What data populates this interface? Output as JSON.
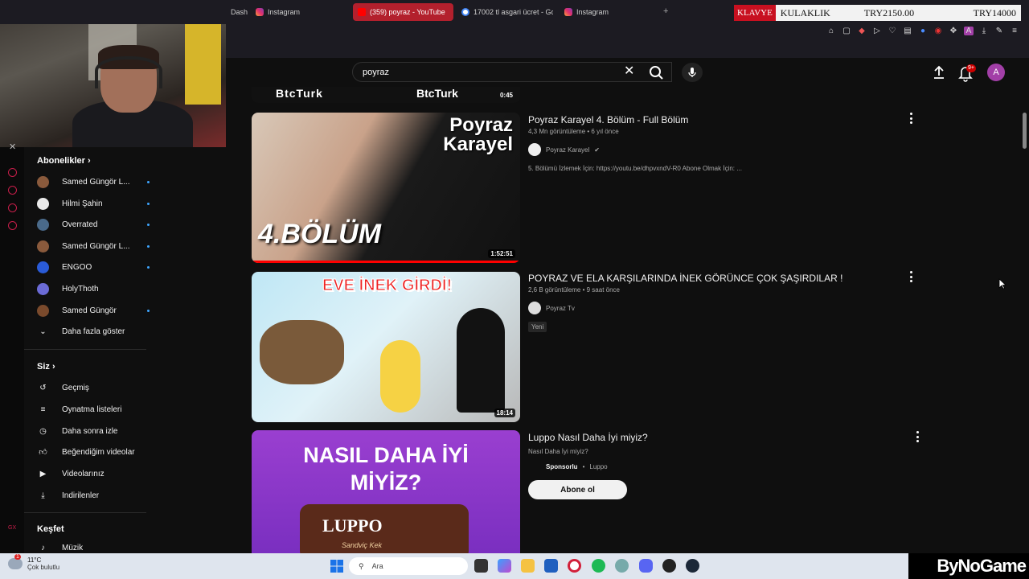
{
  "browser": {
    "tabs": [
      {
        "label": "Dash",
        "icon": "dashboard-icon"
      },
      {
        "label": "Instagram",
        "icon": "instagram-icon"
      },
      {
        "label": "(359) poyraz - YouTube",
        "icon": "youtube-icon",
        "active": true
      },
      {
        "label": "17002 tl asgari ücret - Go",
        "icon": "google-icon"
      },
      {
        "label": "Instagram",
        "icon": "instagram-icon"
      }
    ],
    "new_tab": "+"
  },
  "ticker": {
    "highlight": "KLAVYE",
    "items": [
      "KULAKLIK",
      "TRY2150.00",
      "TRY14000"
    ]
  },
  "youtube": {
    "search_value": "poyraz",
    "notification_count": "9+",
    "avatar_letter": "A"
  },
  "sidebar": {
    "subscriptions_title": "Abonelikler",
    "subscriptions": [
      {
        "label": "Samed Güngör L...",
        "color": "#8a5a3c",
        "dot": true
      },
      {
        "label": "Hilmi Şahin",
        "color": "#e9e9e9",
        "dot": true
      },
      {
        "label": "Overrated",
        "color": "#4a6a8a",
        "dot": true
      },
      {
        "label": "Samed Güngör L...",
        "color": "#8a5a3c",
        "dot": true
      },
      {
        "label": "ENGOO",
        "color": "#2a5bd7",
        "dot": true
      },
      {
        "label": "HolyThoth",
        "color": "#6b6bd6",
        "dot": false
      },
      {
        "label": "Samed Güngör",
        "color": "#7a4a2c",
        "dot": true
      }
    ],
    "show_more": "Daha fazla göster",
    "you_title": "Siz",
    "you_items": [
      {
        "label": "Geçmiş",
        "icon": "history-icon"
      },
      {
        "label": "Oynatma listeleri",
        "icon": "playlist-icon"
      },
      {
        "label": "Daha sonra izle",
        "icon": "watch-later-icon"
      },
      {
        "label": "Beğendiğim videolar",
        "icon": "like-icon"
      },
      {
        "label": "Videolarınız",
        "icon": "video-icon"
      },
      {
        "label": "İndirilenler",
        "icon": "download-icon"
      }
    ],
    "explore_title": "Keşfet",
    "explore_items": [
      {
        "label": "Müzik",
        "icon": "music-icon"
      }
    ]
  },
  "results": [
    {
      "partial_duration": "0:45",
      "partial_text": "BtcTurk"
    },
    {
      "title": "Poyraz Karayel 4. Bölüm - Full Bölüm",
      "meta": "4,3 Mn görüntüleme • 6 yıl önce",
      "channel": "Poyraz Karayel",
      "verified": true,
      "description": "5. Bölümü İzlemek İçin: https://youtu.be/dhpvxndV-R0 Abone Olmak İçin: ...",
      "duration": "1:52:51",
      "thumb_title": "Poyraz Karayel",
      "thumb_episode": "4.BÖLÜM"
    },
    {
      "title": "POYRAZ VE ELA KARŞILARINDA İNEK GÖRÜNCE ÇOK ŞAŞIRDILAR !",
      "meta": "2,6 B görüntüleme • 9 saat önce",
      "channel": "Poyraz Tv",
      "badge": "Yeni",
      "duration": "18:14",
      "thumb_text": "EVE İNEK GİRDİ!"
    },
    {
      "title": "Luppo Nasıl Daha İyi miyiz?",
      "meta": "Nasıl Daha İyi miyiz?",
      "sponsored": "Sponsorlu",
      "channel": "Luppo",
      "button": "Abone ol",
      "thumb_text": "NASIL DAHA İYİ MİYİZ?",
      "thumb_brand": "LUPPO",
      "thumb_sub": "Sandviç Kek"
    }
  ],
  "taskbar": {
    "weather_temp": "11°C",
    "weather_cond": "Çok bulutlu",
    "search_placeholder": "Ara",
    "brand": "ByNoGame"
  }
}
